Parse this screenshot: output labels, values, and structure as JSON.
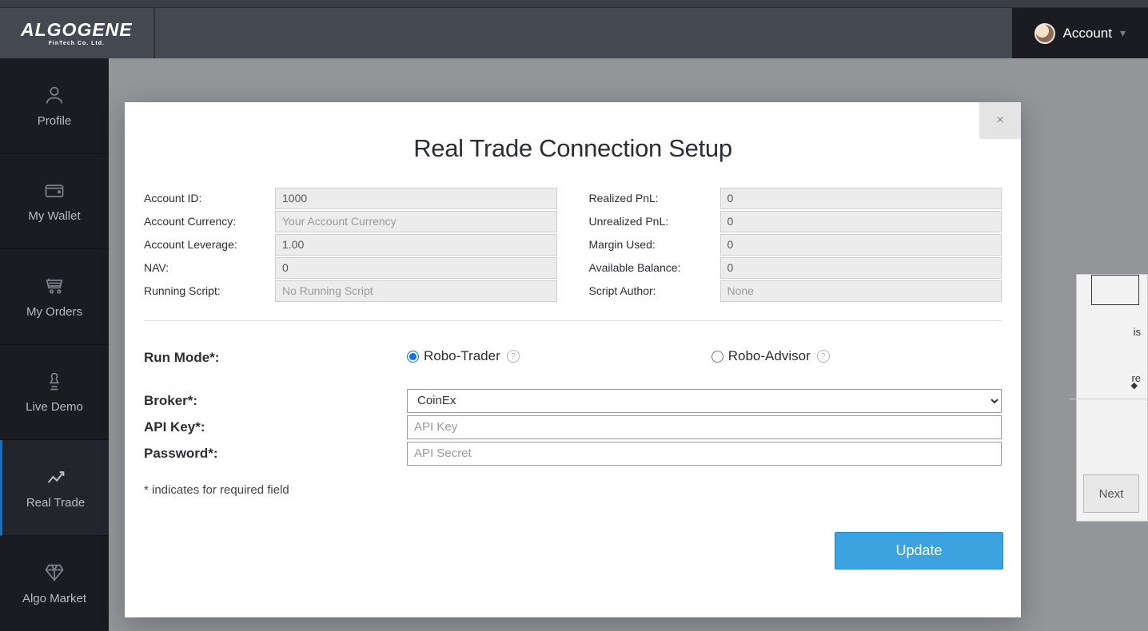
{
  "brand": {
    "name": "ALGOGENE",
    "sub": "FinTech Co. Ltd."
  },
  "header": {
    "account_label": "Account"
  },
  "sidebar": {
    "items": [
      {
        "label": "Profile"
      },
      {
        "label": "My Wallet"
      },
      {
        "label": "My Orders"
      },
      {
        "label": "Live Demo"
      },
      {
        "label": "Real Trade"
      },
      {
        "label": "Algo Market"
      }
    ]
  },
  "modal": {
    "title": "Real Trade Connection Setup",
    "close": "×",
    "left_fields": [
      {
        "label": "Account ID:",
        "value": "1000",
        "placeholder": ""
      },
      {
        "label": "Account Currency:",
        "value": "",
        "placeholder": "Your Account Currency"
      },
      {
        "label": "Account Leverage:",
        "value": "1.00",
        "placeholder": ""
      },
      {
        "label": "NAV:",
        "value": "0",
        "placeholder": ""
      },
      {
        "label": "Running Script:",
        "value": "",
        "placeholder": "No Running Script"
      }
    ],
    "right_fields": [
      {
        "label": "Realized PnL:",
        "value": "0",
        "placeholder": ""
      },
      {
        "label": "Unrealized PnL:",
        "value": "0",
        "placeholder": ""
      },
      {
        "label": "Margin Used:",
        "value": "0",
        "placeholder": ""
      },
      {
        "label": "Available Balance:",
        "value": "0",
        "placeholder": ""
      },
      {
        "label": "Script Author:",
        "value": "",
        "placeholder": "None"
      }
    ],
    "run_mode_label": "Run Mode*:",
    "run_modes": [
      {
        "label": "Robo-Trader",
        "checked": true
      },
      {
        "label": "Robo-Advisor",
        "checked": false
      }
    ],
    "broker_label": "Broker*:",
    "broker_value": "CoinEx",
    "apikey_label": "API Key*:",
    "apikey_placeholder": "API Key",
    "password_label": "Password*:",
    "password_placeholder": "API Secret",
    "footnote": "* indicates for required field",
    "update_label": "Update"
  },
  "bg": {
    "frag1": "is",
    "frag2": "re",
    "next": "Next"
  }
}
